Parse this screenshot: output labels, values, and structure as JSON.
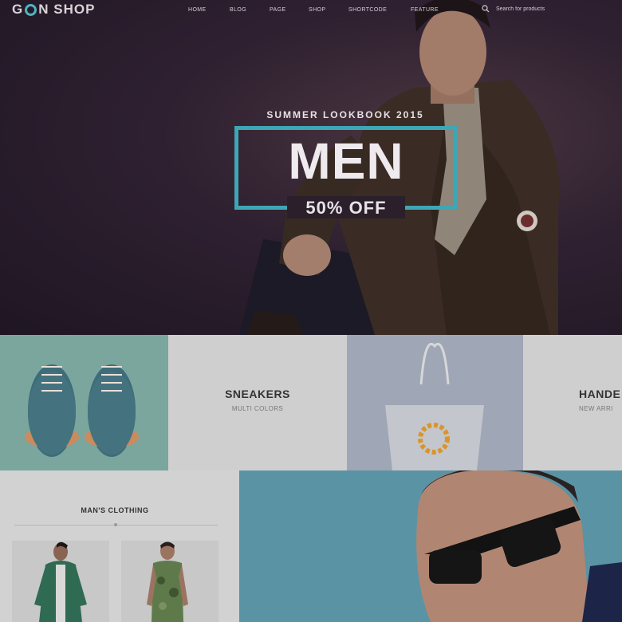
{
  "brand": {
    "logo_left": "G",
    "logo_right": "N SHOP"
  },
  "nav": {
    "items": [
      {
        "label": "HOME"
      },
      {
        "label": "BLOG"
      },
      {
        "label": "PAGE"
      },
      {
        "label": "SHOP"
      },
      {
        "label": "SHORTCODE"
      },
      {
        "label": "FEATURE"
      }
    ]
  },
  "search": {
    "placeholder": "Search for products",
    "icon": "search-icon"
  },
  "hero": {
    "kicker": "SUMMER LOOKBOOK 2015",
    "title": "MEN",
    "subtitle": "50% OFF",
    "accent": "#3fa6b5"
  },
  "categories": [
    {
      "title": "SNEAKERS",
      "subtitle": "MULTI COLORS"
    },
    {
      "title": "HANDE",
      "subtitle": "NEW ARRI"
    }
  ],
  "clothing": {
    "title": "MAN'S CLOTHING"
  },
  "colors": {
    "hero_bg": "#2e2030",
    "tile_teal": "#7aa69e",
    "tile_grey": "#cfcfd0",
    "tile_blue_grey": "#9fa6b5",
    "banner_blue": "#5a93a4"
  }
}
